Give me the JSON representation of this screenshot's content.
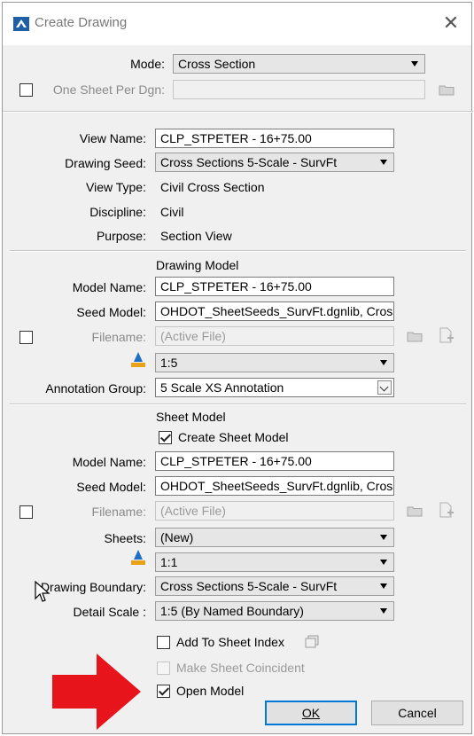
{
  "window": {
    "title": "Create Drawing",
    "close_icon": "close-icon"
  },
  "mode": {
    "label": "Mode:",
    "value": "Cross Section"
  },
  "one_sheet": {
    "label": "One Sheet Per Dgn:",
    "checked": false,
    "value": ""
  },
  "view": {
    "view_name_label": "View Name:",
    "view_name_value": "CLP_STPETER - 16+75.00",
    "drawing_seed_label": "Drawing Seed:",
    "drawing_seed_value": "Cross Sections 5-Scale - SurvFt",
    "view_type_label": "View Type:",
    "view_type_value": "Civil Cross Section",
    "discipline_label": "Discipline:",
    "discipline_value": "Civil",
    "purpose_label": "Purpose:",
    "purpose_value": "Section View"
  },
  "drawing_model": {
    "heading": "Drawing Model",
    "model_name_label": "Model Name:",
    "model_name_value": "CLP_STPETER - 16+75.00",
    "seed_model_label": "Seed Model:",
    "seed_model_value": "OHDOT_SheetSeeds_SurvFt.dgnlib, Cross",
    "filename_label": "Filename:",
    "filename_value": "(Active File)",
    "scale_value": "1:5",
    "annotation_group_label": "Annotation Group:",
    "annotation_group_value": "5 Scale XS Annotation"
  },
  "sheet_model": {
    "heading": "Sheet Model",
    "create_label": "Create Sheet Model",
    "create_checked": true,
    "model_name_label": "Model Name:",
    "model_name_value": "CLP_STPETER - 16+75.00",
    "seed_model_label": "Seed Model:",
    "seed_model_value": "OHDOT_SheetSeeds_SurvFt.dgnlib, Cross",
    "filename_label": "Filename:",
    "filename_value": "(Active File)",
    "sheets_label": "Sheets:",
    "sheets_value": "(New)",
    "scale_value": "1:1",
    "boundary_label": "Drawing Boundary:",
    "boundary_value": "Cross Sections 5-Scale - SurvFt",
    "detail_scale_label": "Detail Scale :",
    "detail_scale_value": "1:5 (By Named Boundary)"
  },
  "options": {
    "add_to_index_label": "Add To Sheet Index",
    "add_to_index_checked": false,
    "coincident_label": "Make Sheet Coincident",
    "coincident_checked": false,
    "open_model_label": "Open Model",
    "open_model_checked": true
  },
  "buttons": {
    "ok": "OK",
    "cancel": "Cancel"
  },
  "colors": {
    "annotation_arrow": "#e8141c",
    "focus_border": "#0078d7"
  }
}
